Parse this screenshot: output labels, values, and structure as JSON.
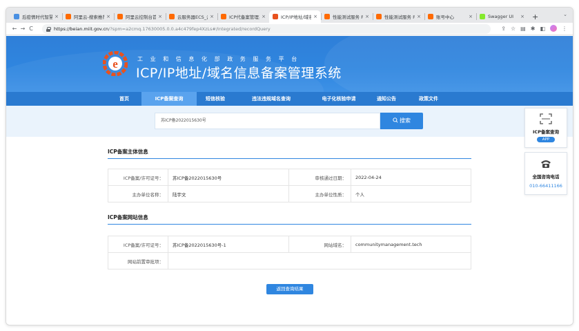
{
  "browser": {
    "tabs": [
      {
        "title": "后疫情时代智慧",
        "favicon_color": "#4a90e2",
        "active": false
      },
      {
        "title": "阿里云-搜索推荐",
        "favicon_color": "#ff6a00",
        "active": false
      },
      {
        "title": "阿里云控制台首页",
        "favicon_color": "#ff6a00",
        "active": false
      },
      {
        "title": "云服务器ECS_云",
        "favicon_color": "#ff6a00",
        "active": false
      },
      {
        "title": "ICP代备案管理系",
        "favicon_color": "#ff6a00",
        "active": false
      },
      {
        "title": "ICP/IP地址/域名",
        "favicon_color": "#e8521f",
        "active": true
      },
      {
        "title": "性能测试服务 PTS",
        "favicon_color": "#ff6a00",
        "active": false
      },
      {
        "title": "性能测试服务 PTS",
        "favicon_color": "#ff6a00",
        "active": false
      },
      {
        "title": "账号中心",
        "favicon_color": "#ff6a00",
        "active": false
      },
      {
        "title": "Swagger UI",
        "favicon_color": "#85ea2d",
        "active": false
      }
    ],
    "new_tab": "+",
    "tab_close": "×",
    "url_host": "https://beian.miit.gov.cn",
    "url_rest": "/?spm=a2cmq.17630005.0.0.a4c479fep4XzLs#/Integrated/recordQuery",
    "nav": {
      "back": "←",
      "forward": "→",
      "reload": "C"
    },
    "icons": {
      "share": "⇪",
      "star": "☆",
      "reader": "▤",
      "extensions": "✱",
      "sidebar": "◧",
      "menu": "⋮",
      "tab_menu": "⌄"
    }
  },
  "site": {
    "subtitle": "工业和信息化部政务服务平台",
    "title": "ICP/IP地址/域名信息备案管理系统",
    "nav": [
      {
        "label": "首页",
        "active": false
      },
      {
        "label": "ICP备案查询",
        "active": true
      },
      {
        "label": "短信核验",
        "active": false
      },
      {
        "label": "违法违规域名查询",
        "active": false
      },
      {
        "label": "电子化核验申请",
        "active": false
      },
      {
        "label": "通知公告",
        "active": false
      },
      {
        "label": "政策文件",
        "active": false
      }
    ],
    "search": {
      "value": "苏ICP备2022015630号",
      "button": "搜索"
    }
  },
  "subject": {
    "title": "ICP备案主体信息",
    "rows": [
      [
        "ICP备案/许可证号：",
        "苏ICP备2022015630号",
        "审核通过日期：",
        "2022-04-24"
      ],
      [
        "主办单位名称：",
        "陆宇文",
        "主办单位性质：",
        "个人"
      ]
    ]
  },
  "website": {
    "title": "ICP备案网站信息",
    "rows": [
      [
        "ICP备案/许可证号：",
        "苏ICP备2022015630号-1",
        "网站域名：",
        "communitymanagement.tech"
      ],
      [
        "网站前置审批项：",
        "",
        "",
        ""
      ]
    ]
  },
  "back_button": "返回查询结果",
  "sidebar": {
    "app_label": "ICP备案查询",
    "app_badge": "APP",
    "phone_label": "全国咨询电话",
    "phone_number": "010-66411166"
  },
  "colors": {
    "primary": "#2f86e0",
    "nav_bg": "#2a7ad0",
    "nav_active": "#5aa3ee",
    "logo_orange": "#e8521f"
  }
}
